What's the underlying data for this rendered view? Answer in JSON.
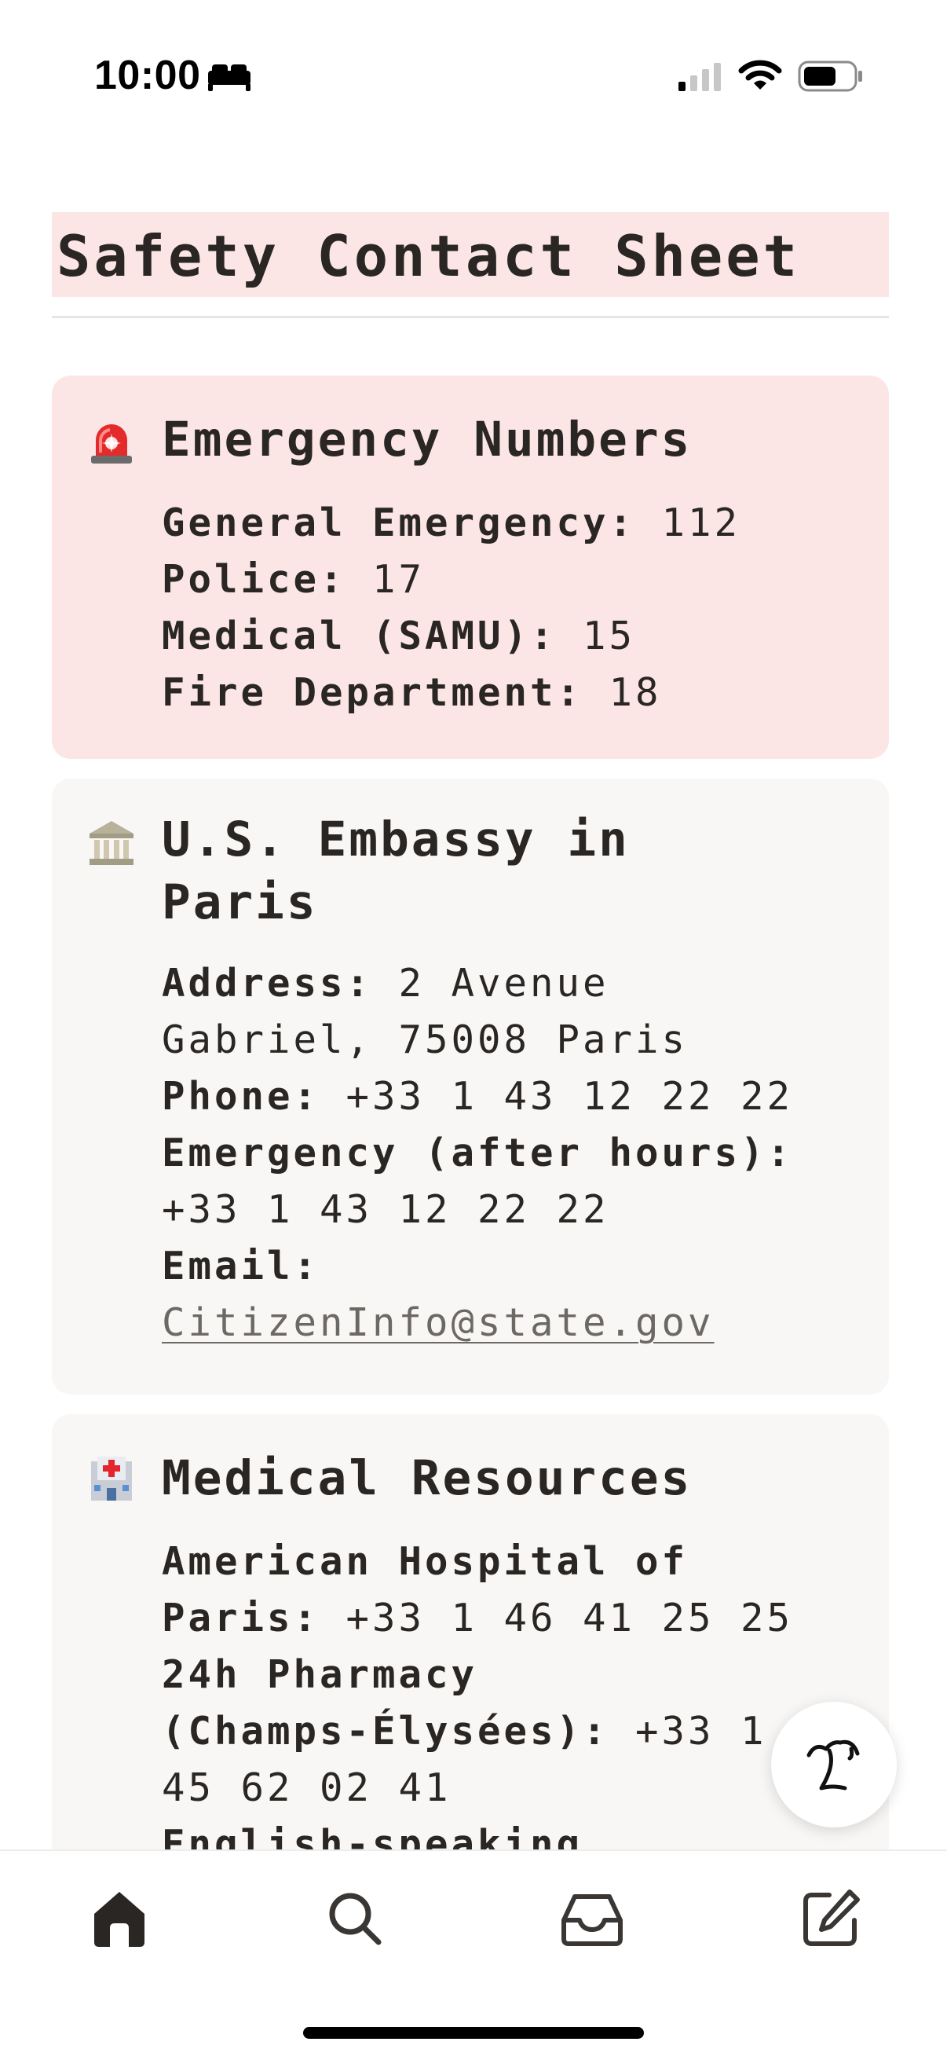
{
  "status_bar": {
    "time": "10:00",
    "icons": [
      "sleep-icon",
      "cellular-signal-icon",
      "wifi-icon",
      "battery-icon"
    ]
  },
  "page": {
    "title": "Safety Contact Sheet"
  },
  "colors": {
    "emergency_card_bg": "#fbe6e5",
    "card_bg": "#f8f7f5",
    "text": "#2a2623",
    "link": "#6c6864"
  },
  "cards": {
    "emergency": {
      "icon": "rotating-light-icon",
      "title": "Emergency Numbers",
      "rows": [
        {
          "label": "General Emergency:",
          "value": " 112"
        },
        {
          "label": "Police:",
          "value": " 17"
        },
        {
          "label": "Medical (SAMU):",
          "value": " 15"
        },
        {
          "label": "Fire Department:",
          "value": " 18"
        }
      ]
    },
    "embassy": {
      "icon": "classical-building-icon",
      "title_line1": "U.S. Embassy in",
      "title_line2": "Paris",
      "address_label": "Address:",
      "address_line1": " 2 Avenue",
      "address_line2": "Gabriel, 75008 Paris",
      "phone_label": "Phone:",
      "phone_value": " +33 1 43 12 22 22",
      "after_hours_label": "Emergency (after hours):",
      "after_hours_value": "+33 1 43 12 22 22",
      "email_label": "Email:",
      "email_value": "CitizenInfo@state.gov"
    },
    "medical": {
      "icon": "hospital-icon",
      "title": "Medical Resources",
      "hospital_label_line1": "American Hospital of",
      "hospital_label_line2": "Paris:",
      "hospital_value": " +33 1 46 41 25 25",
      "pharmacy_label_line1": "24h Pharmacy",
      "pharmacy_label_line2": "(Champs-Élysées):",
      "pharmacy_value_line1": " +33 1",
      "pharmacy_value_line2": "45 62 02 41",
      "next_label": "English-speaking"
    }
  },
  "fab": {
    "icon": "assistant-face-icon"
  },
  "bottom_nav": {
    "items": [
      {
        "icon": "home-icon",
        "active": true
      },
      {
        "icon": "search-icon",
        "active": false
      },
      {
        "icon": "inbox-icon",
        "active": false
      },
      {
        "icon": "compose-icon",
        "active": false
      }
    ]
  }
}
